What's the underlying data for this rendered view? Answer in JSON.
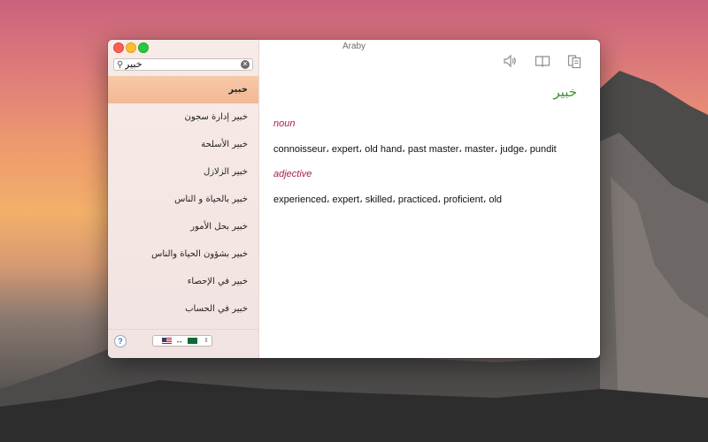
{
  "window": {
    "title": "Araby"
  },
  "search": {
    "value": "خبير"
  },
  "results": [
    "خبير",
    "خبير إدارة سجون",
    "خبير الأسلحة",
    "خبير الزلازل",
    "خبير بالحياة و الناس",
    "خبير بحل الأمور",
    "خبير بشؤون الحياة والناس",
    "خبير في الإحصاء",
    "خبير في الحساب"
  ],
  "entry": {
    "word": "خبير",
    "senses": [
      {
        "pos": "noun",
        "meaning": "connoisseur، expert، old hand، past master، master، judge، pundit"
      },
      {
        "pos": "adjective",
        "meaning": "experienced، expert، skilled، practiced، proficient، old"
      }
    ]
  },
  "footer": {
    "help_label": "?",
    "swap_glyph": "↔",
    "updown_glyph": "⇕"
  },
  "icons": {
    "speaker": "speaker-icon",
    "dictionary": "book-icon",
    "copy": "copy-icon"
  },
  "colors": {
    "accent_selected": "#f3b895",
    "entry_word": "#3e8f2d",
    "part_of_speech": "#a3224b"
  }
}
